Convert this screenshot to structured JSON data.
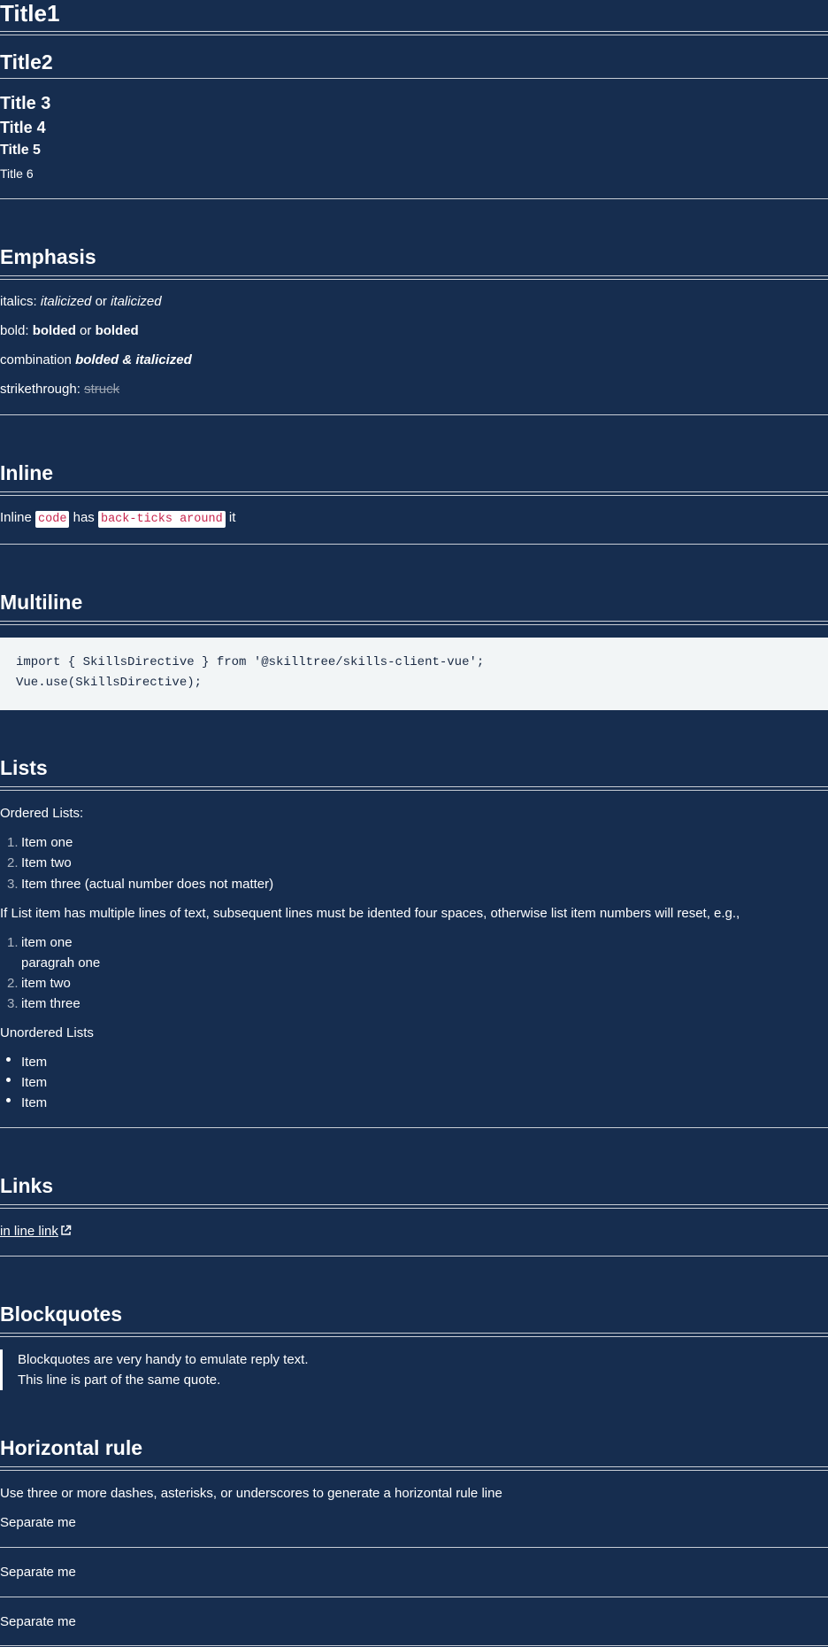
{
  "titles": {
    "t1": "Title1",
    "t2": "Title2",
    "t3": "Title 3",
    "t4": "Title 4",
    "t5": "Title 5",
    "t6": "Title 6"
  },
  "emphasis": {
    "heading": "Emphasis",
    "italics_label": "italics:",
    "italics_a": "italicized",
    "or1": "or",
    "italics_b": "italicized",
    "bold_label": "bold:",
    "bold_a": "bolded",
    "or2": "or",
    "bold_b": "bolded",
    "combo_label": "combination",
    "combo": "bolded & italicized",
    "strike_label": "strikethrough:",
    "strike": "struck"
  },
  "inline": {
    "heading": "Inline",
    "pre": "Inline",
    "code1": "code",
    "mid": "has",
    "code2": "back-ticks around",
    "post": "it"
  },
  "multiline": {
    "heading": "Multiline",
    "line1": "import { SkillsDirective } from '@skilltree/skills-client-vue';",
    "line2": "Vue.use(SkillsDirective);"
  },
  "lists": {
    "heading": "Lists",
    "ordered_label": "Ordered Lists:",
    "ordered": [
      {
        "num": "1.",
        "text": "Item one"
      },
      {
        "num": "2.",
        "text": "Item two"
      },
      {
        "num": "3.",
        "text": "Item three (actual number does not matter)"
      }
    ],
    "note": "If List item has multiple lines of text, subsequent lines must be idented four spaces, otherwise list item numbers will reset, e.g.,",
    "ordered2": [
      {
        "num": "1.",
        "text": "item one"
      },
      {
        "num": "",
        "text": "paragrah one"
      },
      {
        "num": "2.",
        "text": "item two"
      },
      {
        "num": "3.",
        "text": "item three"
      }
    ],
    "unordered_label": "Unordered Lists",
    "unordered": [
      "Item",
      "Item",
      "Item"
    ]
  },
  "links": {
    "heading": "Links",
    "link_text": "in line link",
    "icon": "external-link-icon"
  },
  "blockquotes": {
    "heading": "Blockquotes",
    "line1": "Blockquotes are very handy to emulate reply text.",
    "line2": "This line is part of the same quote."
  },
  "hr": {
    "heading": "Horizontal rule",
    "desc": "Use three or more dashes, asterisks, or underscores to generate a horizontal rule line",
    "sep1": "Separate me",
    "sep2": "Separate me",
    "sep3": "Separate me"
  }
}
